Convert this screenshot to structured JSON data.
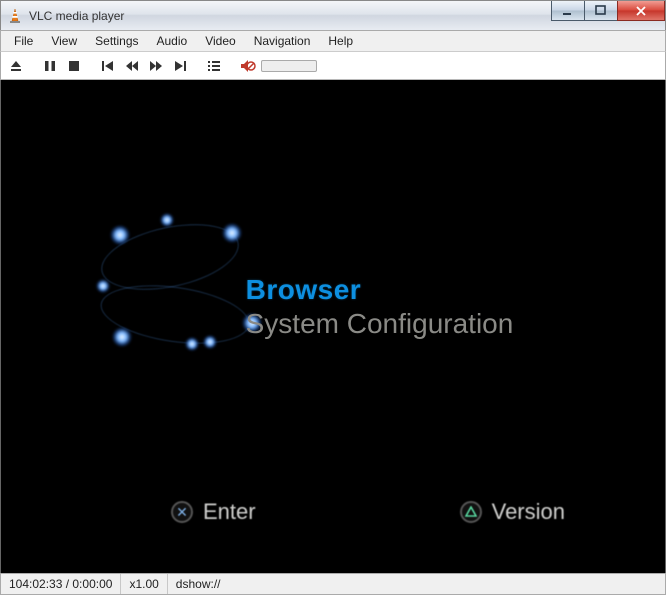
{
  "window": {
    "title": "VLC media player"
  },
  "menu": {
    "items": [
      "File",
      "View",
      "Settings",
      "Audio",
      "Video",
      "Navigation",
      "Help"
    ]
  },
  "toolbar": {
    "icons": [
      "eject",
      "pause",
      "stop",
      "prev",
      "rewind",
      "forward",
      "next",
      "playlist",
      "mute"
    ]
  },
  "content": {
    "browser": "Browser",
    "sysconf": "System Configuration",
    "enter_label": "Enter",
    "version_label": "Version"
  },
  "status": {
    "time": "104:02:33 / 0:00:00",
    "speed": "x1.00",
    "source": "dshow://"
  }
}
